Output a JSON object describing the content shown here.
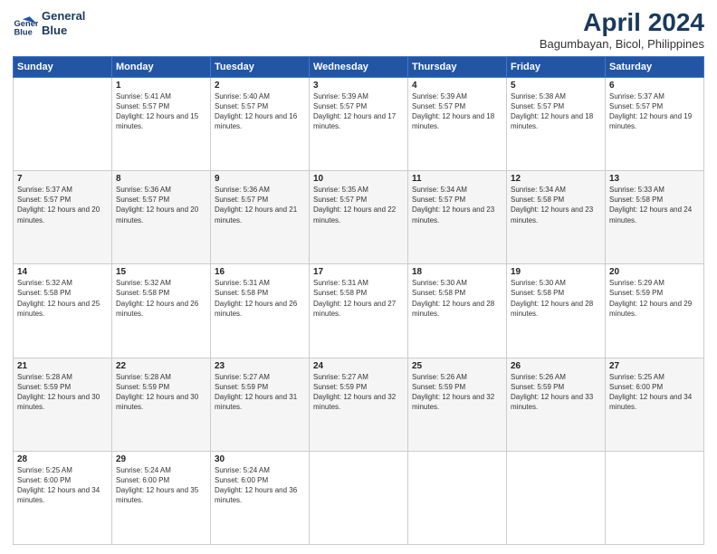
{
  "logo": {
    "line1": "General",
    "line2": "Blue"
  },
  "title": "April 2024",
  "subtitle": "Bagumbayan, Bicol, Philippines",
  "header_days": [
    "Sunday",
    "Monday",
    "Tuesday",
    "Wednesday",
    "Thursday",
    "Friday",
    "Saturday"
  ],
  "weeks": [
    [
      {
        "day": "",
        "sunrise": "",
        "sunset": "",
        "daylight": ""
      },
      {
        "day": "1",
        "sunrise": "Sunrise: 5:41 AM",
        "sunset": "Sunset: 5:57 PM",
        "daylight": "Daylight: 12 hours and 15 minutes."
      },
      {
        "day": "2",
        "sunrise": "Sunrise: 5:40 AM",
        "sunset": "Sunset: 5:57 PM",
        "daylight": "Daylight: 12 hours and 16 minutes."
      },
      {
        "day": "3",
        "sunrise": "Sunrise: 5:39 AM",
        "sunset": "Sunset: 5:57 PM",
        "daylight": "Daylight: 12 hours and 17 minutes."
      },
      {
        "day": "4",
        "sunrise": "Sunrise: 5:39 AM",
        "sunset": "Sunset: 5:57 PM",
        "daylight": "Daylight: 12 hours and 18 minutes."
      },
      {
        "day": "5",
        "sunrise": "Sunrise: 5:38 AM",
        "sunset": "Sunset: 5:57 PM",
        "daylight": "Daylight: 12 hours and 18 minutes."
      },
      {
        "day": "6",
        "sunrise": "Sunrise: 5:37 AM",
        "sunset": "Sunset: 5:57 PM",
        "daylight": "Daylight: 12 hours and 19 minutes."
      }
    ],
    [
      {
        "day": "7",
        "sunrise": "Sunrise: 5:37 AM",
        "sunset": "Sunset: 5:57 PM",
        "daylight": "Daylight: 12 hours and 20 minutes."
      },
      {
        "day": "8",
        "sunrise": "Sunrise: 5:36 AM",
        "sunset": "Sunset: 5:57 PM",
        "daylight": "Daylight: 12 hours and 20 minutes."
      },
      {
        "day": "9",
        "sunrise": "Sunrise: 5:36 AM",
        "sunset": "Sunset: 5:57 PM",
        "daylight": "Daylight: 12 hours and 21 minutes."
      },
      {
        "day": "10",
        "sunrise": "Sunrise: 5:35 AM",
        "sunset": "Sunset: 5:57 PM",
        "daylight": "Daylight: 12 hours and 22 minutes."
      },
      {
        "day": "11",
        "sunrise": "Sunrise: 5:34 AM",
        "sunset": "Sunset: 5:57 PM",
        "daylight": "Daylight: 12 hours and 23 minutes."
      },
      {
        "day": "12",
        "sunrise": "Sunrise: 5:34 AM",
        "sunset": "Sunset: 5:58 PM",
        "daylight": "Daylight: 12 hours and 23 minutes."
      },
      {
        "day": "13",
        "sunrise": "Sunrise: 5:33 AM",
        "sunset": "Sunset: 5:58 PM",
        "daylight": "Daylight: 12 hours and 24 minutes."
      }
    ],
    [
      {
        "day": "14",
        "sunrise": "Sunrise: 5:32 AM",
        "sunset": "Sunset: 5:58 PM",
        "daylight": "Daylight: 12 hours and 25 minutes."
      },
      {
        "day": "15",
        "sunrise": "Sunrise: 5:32 AM",
        "sunset": "Sunset: 5:58 PM",
        "daylight": "Daylight: 12 hours and 26 minutes."
      },
      {
        "day": "16",
        "sunrise": "Sunrise: 5:31 AM",
        "sunset": "Sunset: 5:58 PM",
        "daylight": "Daylight: 12 hours and 26 minutes."
      },
      {
        "day": "17",
        "sunrise": "Sunrise: 5:31 AM",
        "sunset": "Sunset: 5:58 PM",
        "daylight": "Daylight: 12 hours and 27 minutes."
      },
      {
        "day": "18",
        "sunrise": "Sunrise: 5:30 AM",
        "sunset": "Sunset: 5:58 PM",
        "daylight": "Daylight: 12 hours and 28 minutes."
      },
      {
        "day": "19",
        "sunrise": "Sunrise: 5:30 AM",
        "sunset": "Sunset: 5:58 PM",
        "daylight": "Daylight: 12 hours and 28 minutes."
      },
      {
        "day": "20",
        "sunrise": "Sunrise: 5:29 AM",
        "sunset": "Sunset: 5:59 PM",
        "daylight": "Daylight: 12 hours and 29 minutes."
      }
    ],
    [
      {
        "day": "21",
        "sunrise": "Sunrise: 5:28 AM",
        "sunset": "Sunset: 5:59 PM",
        "daylight": "Daylight: 12 hours and 30 minutes."
      },
      {
        "day": "22",
        "sunrise": "Sunrise: 5:28 AM",
        "sunset": "Sunset: 5:59 PM",
        "daylight": "Daylight: 12 hours and 30 minutes."
      },
      {
        "day": "23",
        "sunrise": "Sunrise: 5:27 AM",
        "sunset": "Sunset: 5:59 PM",
        "daylight": "Daylight: 12 hours and 31 minutes."
      },
      {
        "day": "24",
        "sunrise": "Sunrise: 5:27 AM",
        "sunset": "Sunset: 5:59 PM",
        "daylight": "Daylight: 12 hours and 32 minutes."
      },
      {
        "day": "25",
        "sunrise": "Sunrise: 5:26 AM",
        "sunset": "Sunset: 5:59 PM",
        "daylight": "Daylight: 12 hours and 32 minutes."
      },
      {
        "day": "26",
        "sunrise": "Sunrise: 5:26 AM",
        "sunset": "Sunset: 5:59 PM",
        "daylight": "Daylight: 12 hours and 33 minutes."
      },
      {
        "day": "27",
        "sunrise": "Sunrise: 5:25 AM",
        "sunset": "Sunset: 6:00 PM",
        "daylight": "Daylight: 12 hours and 34 minutes."
      }
    ],
    [
      {
        "day": "28",
        "sunrise": "Sunrise: 5:25 AM",
        "sunset": "Sunset: 6:00 PM",
        "daylight": "Daylight: 12 hours and 34 minutes."
      },
      {
        "day": "29",
        "sunrise": "Sunrise: 5:24 AM",
        "sunset": "Sunset: 6:00 PM",
        "daylight": "Daylight: 12 hours and 35 minutes."
      },
      {
        "day": "30",
        "sunrise": "Sunrise: 5:24 AM",
        "sunset": "Sunset: 6:00 PM",
        "daylight": "Daylight: 12 hours and 36 minutes."
      },
      {
        "day": "",
        "sunrise": "",
        "sunset": "",
        "daylight": ""
      },
      {
        "day": "",
        "sunrise": "",
        "sunset": "",
        "daylight": ""
      },
      {
        "day": "",
        "sunrise": "",
        "sunset": "",
        "daylight": ""
      },
      {
        "day": "",
        "sunrise": "",
        "sunset": "",
        "daylight": ""
      }
    ]
  ]
}
